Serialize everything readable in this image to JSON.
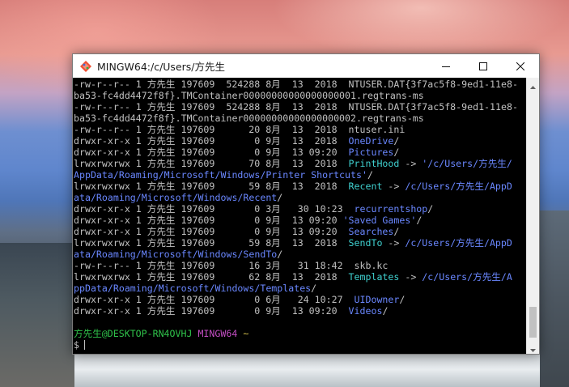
{
  "window": {
    "title": "MINGW64:/c/Users/方先生",
    "icon": "git-bash-icon",
    "controls": [
      "minimize-icon",
      "maximize-icon",
      "close-icon"
    ]
  },
  "terminal": {
    "lines": [
      [
        {
          "t": "-rw-r--r-- 1 方先生 197609  524288 8月  13  2018  NTUSER.DAT{3f7ac5f8-9ed1-11e8-",
          "c": "plain"
        }
      ],
      [
        {
          "t": "ba53-fc4dd4472f8f}.TMContainer00000000000000000001.regtrans-ms",
          "c": "plain"
        }
      ],
      [
        {
          "t": "-rw-r--r-- 1 方先生 197609  524288 8月  13  2018  NTUSER.DAT{3f7ac5f8-9ed1-11e8-",
          "c": "plain"
        }
      ],
      [
        {
          "t": "ba53-fc4dd4472f8f}.TMContainer00000000000000000002.regtrans-ms",
          "c": "plain"
        }
      ],
      [
        {
          "t": "-rw-r--r-- 1 方先生 197609      20 8月  13  2018  ntuser.ini",
          "c": "plain"
        }
      ],
      [
        {
          "t": "drwxr-xr-x 1 方先生 197609       0 9月  13  2018  ",
          "c": "plain"
        },
        {
          "t": "OneDrive",
          "c": "dir"
        },
        {
          "t": "/",
          "c": "plain"
        }
      ],
      [
        {
          "t": "drwxr-xr-x 1 方先生 197609       0 9月  13 09:20  ",
          "c": "plain"
        },
        {
          "t": "Pictures",
          "c": "dir"
        },
        {
          "t": "/",
          "c": "plain"
        }
      ],
      [
        {
          "t": "lrwxrwxrwx 1 方先生 197609      70 8月  13  2018  ",
          "c": "plain"
        },
        {
          "t": "PrintHood",
          "c": "lnk"
        },
        {
          "t": " -> ",
          "c": "plain"
        },
        {
          "t": "'/c/Users/方先生/",
          "c": "dir"
        }
      ],
      [
        {
          "t": "AppData/Roaming/Microsoft/Windows/Printer Shortcuts'",
          "c": "dir"
        },
        {
          "t": "/",
          "c": "plain"
        }
      ],
      [
        {
          "t": "lrwxrwxrwx 1 方先生 197609      59 8月  13  2018  ",
          "c": "plain"
        },
        {
          "t": "Recent",
          "c": "lnk"
        },
        {
          "t": " -> ",
          "c": "plain"
        },
        {
          "t": "/c/Users/方先生/AppD",
          "c": "dir"
        }
      ],
      [
        {
          "t": "ata/Roaming/Microsoft/Windows/Recent",
          "c": "dir"
        },
        {
          "t": "/",
          "c": "plain"
        }
      ],
      [
        {
          "t": "drwxr-xr-x 1 方先生 197609       0 3月   30 10:23  ",
          "c": "plain"
        },
        {
          "t": "recurrentshop",
          "c": "dir"
        },
        {
          "t": "/",
          "c": "plain"
        }
      ],
      [
        {
          "t": "drwxr-xr-x 1 方先生 197609       0 9月  13 09:20 ",
          "c": "plain"
        },
        {
          "t": "'Saved Games'",
          "c": "dir"
        },
        {
          "t": "/",
          "c": "plain"
        }
      ],
      [
        {
          "t": "drwxr-xr-x 1 方先生 197609       0 9月  13 09:20  ",
          "c": "plain"
        },
        {
          "t": "Searches",
          "c": "dir"
        },
        {
          "t": "/",
          "c": "plain"
        }
      ],
      [
        {
          "t": "lrwxrwxrwx 1 方先生 197609      59 8月  13  2018  ",
          "c": "plain"
        },
        {
          "t": "SendTo",
          "c": "lnk"
        },
        {
          "t": " -> ",
          "c": "plain"
        },
        {
          "t": "/c/Users/方先生/AppD",
          "c": "dir"
        }
      ],
      [
        {
          "t": "ata/Roaming/Microsoft/Windows/SendTo",
          "c": "dir"
        },
        {
          "t": "/",
          "c": "plain"
        }
      ],
      [
        {
          "t": "-rw-r--r-- 1 方先生 197609      16 3月   31 18:42  skb.kc",
          "c": "plain"
        }
      ],
      [
        {
          "t": "lrwxrwxrwx 1 方先生 197609      62 8月  13  2018  ",
          "c": "plain"
        },
        {
          "t": "Templates",
          "c": "lnk"
        },
        {
          "t": " -> ",
          "c": "plain"
        },
        {
          "t": "/c/Users/方先生/A",
          "c": "dir"
        }
      ],
      [
        {
          "t": "ppData/Roaming/Microsoft/Windows/Templates",
          "c": "dir"
        },
        {
          "t": "/",
          "c": "plain"
        }
      ],
      [
        {
          "t": "drwxr-xr-x 1 方先生 197609       0 6月   24 10:27  ",
          "c": "plain"
        },
        {
          "t": "UIDowner",
          "c": "dir"
        },
        {
          "t": "/",
          "c": "plain"
        }
      ],
      [
        {
          "t": "drwxr-xr-x 1 方先生 197609       0 9月  13 09:20  ",
          "c": "plain"
        },
        {
          "t": "Videos",
          "c": "dir"
        },
        {
          "t": "/",
          "c": "plain"
        }
      ],
      [
        {
          "t": "",
          "c": "plain"
        }
      ],
      [
        {
          "t": "方先生@DESKTOP-RN4OVHJ",
          "c": "user"
        },
        {
          "t": " ",
          "c": "plain"
        },
        {
          "t": "MINGW64",
          "c": "mingw"
        },
        {
          "t": " ",
          "c": "plain"
        },
        {
          "t": "~",
          "c": "tilde"
        }
      ],
      [
        {
          "t": "$",
          "c": "plain"
        }
      ]
    ],
    "colors": {
      "background": "#000000",
      "text": "#c0c0c0",
      "directory": "#6a87ff",
      "symlink": "#3fd0cf",
      "user_host": "#2fc24a",
      "mingw": "#c34ec3",
      "path": "#d8c44e"
    }
  },
  "scrollbar": {
    "up_icon": "scroll-up-arrow-icon",
    "down_icon": "scroll-down-arrow-icon"
  }
}
